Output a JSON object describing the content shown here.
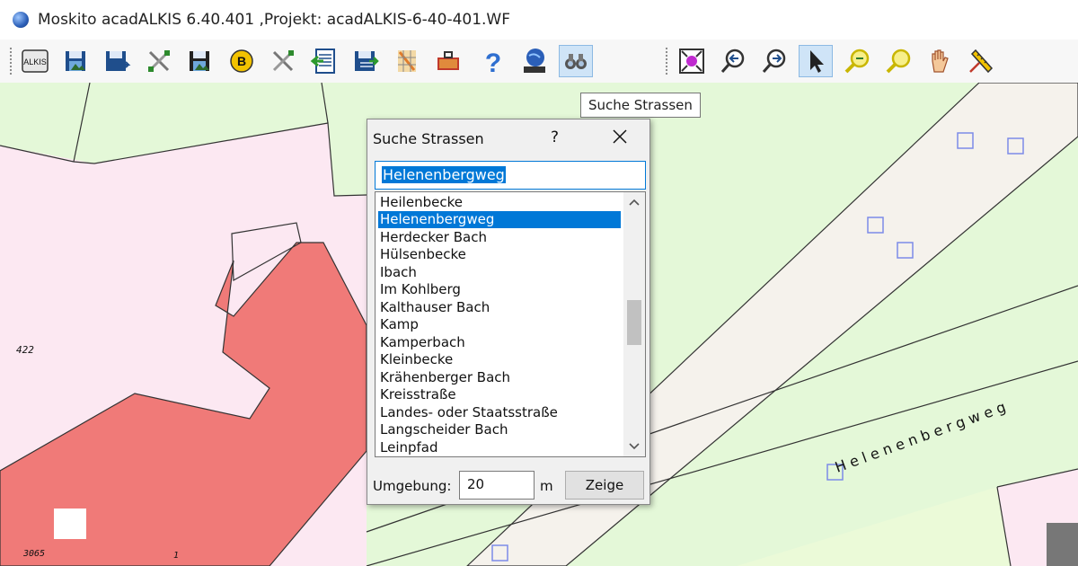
{
  "window": {
    "title": "Moskito acadALKIS 6.40.401 ,Projekt: acadALKIS-6-40-401.WF"
  },
  "toolbar": {
    "tools": [
      {
        "icon": "alkis-icon",
        "text": "ALKIS"
      },
      {
        "icon": "save-image-icon"
      },
      {
        "icon": "save-export-icon"
      },
      {
        "icon": "tools-icon"
      },
      {
        "icon": "print-image-icon"
      },
      {
        "icon": "b-circle-icon",
        "text": "B"
      },
      {
        "icon": "tools-2-icon"
      },
      {
        "icon": "import-document-icon"
      },
      {
        "icon": "export-document-icon"
      },
      {
        "icon": "map-grid-icon"
      },
      {
        "icon": "toolbox-icon"
      },
      {
        "icon": "help-icon",
        "text": "?"
      },
      {
        "icon": "moskito-globe-icon"
      },
      {
        "icon": "binoculars-icon"
      },
      {
        "icon": "zoom-extents-icon"
      },
      {
        "icon": "zoom-back-icon"
      },
      {
        "icon": "zoom-forward-icon"
      },
      {
        "icon": "select-arrow-icon"
      },
      {
        "icon": "zoom-in-icon"
      },
      {
        "icon": "zoom-out-icon"
      },
      {
        "icon": "pan-hand-icon"
      },
      {
        "icon": "measure-icon"
      }
    ],
    "overflow": "»",
    "tooltip": "Suche Strassen"
  },
  "map": {
    "labels": [
      "422",
      "3065",
      "1"
    ],
    "street_label": "Helenenbergweg"
  },
  "dialog": {
    "title": "Suche Strassen",
    "help": "?",
    "search_value": "Helenenbergweg",
    "list_items": [
      "Heilenbecke",
      "Helenenbergweg",
      "Herdecker Bach",
      "Hülsenbecke",
      "Ibach",
      "Im Kohlberg",
      "Kalthauser Bach",
      "Kamp",
      "Kamperbach",
      "Kleinbecke",
      "Krähenberger Bach",
      "Kreisstraße",
      "Landes- oder Staatsstraße",
      "Langscheider Bach",
      "Leinpfad"
    ],
    "selected_item": "Helenenbergweg",
    "distance_label": "Umgebung:",
    "distance_value": "20",
    "distance_unit": "m",
    "show_button": "Zeige"
  },
  "colors": {
    "selection": "#0078d7",
    "parcel_green": "#e4f8d8",
    "parcel_pink": "#fce8f2",
    "building_red": "#f07a78",
    "road": "#f5f2ec"
  }
}
